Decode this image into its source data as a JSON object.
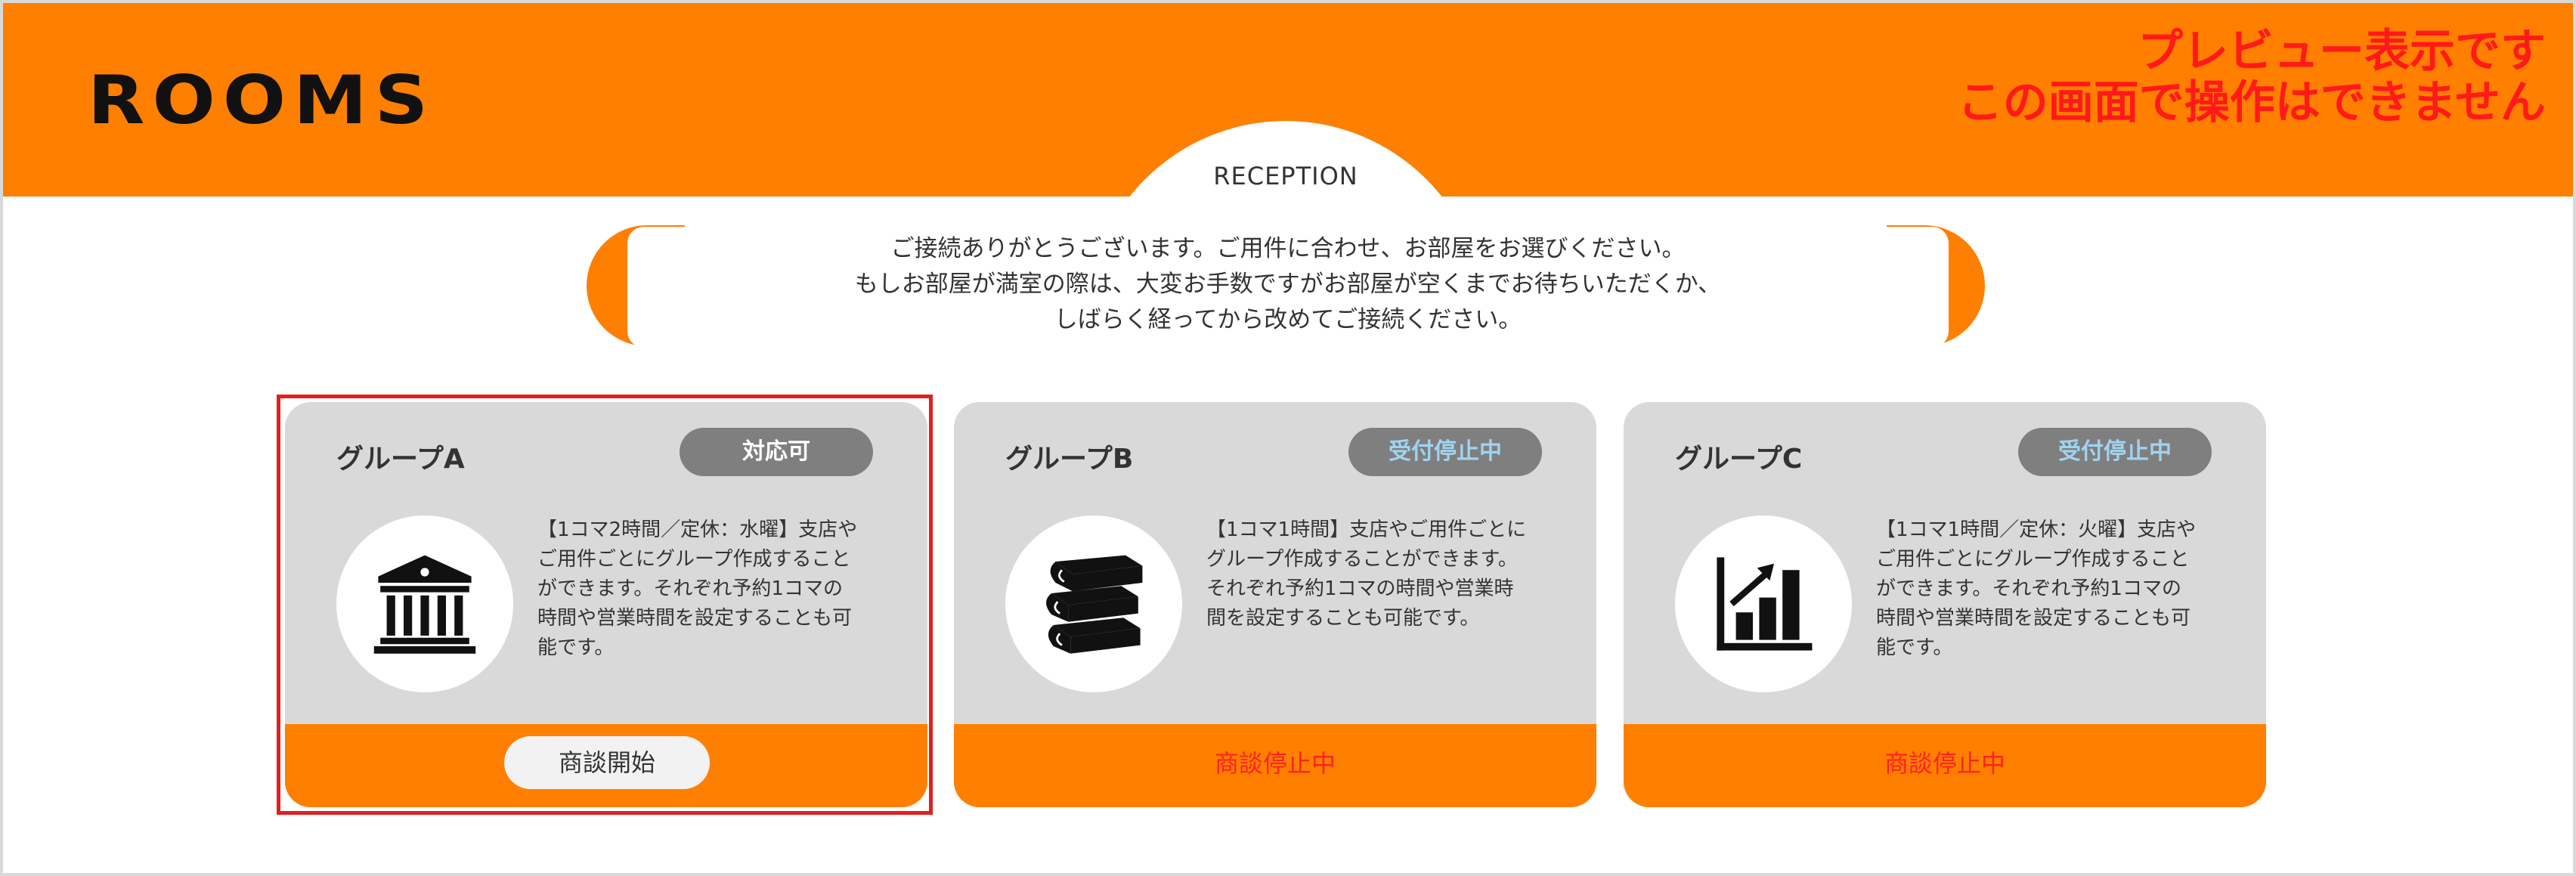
{
  "header": {
    "logo": "ROOMS",
    "preview_notice": [
      "プレビュー表示です",
      "この画面で操作はできません"
    ]
  },
  "reception": {
    "title": "RECEPTION",
    "message": [
      "ご接続ありがとうございます。ご用件に合わせ、お部屋をお選びください。",
      "もしお部屋が満室の際は、大変お手数ですがお部屋が空くまでお待ちいただくか、",
      "しばらく経ってから改めてご接続ください。"
    ]
  },
  "colors": {
    "accent": "#ff7f00",
    "card": "#d9d9d9",
    "badge": "#7f7f7f",
    "stopped_text": "#ff2222",
    "selection": "#e02020"
  },
  "groups": [
    {
      "name": "グループA",
      "status": "対応可",
      "icon": "bank-icon",
      "description": [
        "【1コマ2時間／定休：水曜】支店や",
        "ご用件ごとにグループ作成すること",
        "ができます。それぞれ予約1コマの",
        "時間や営業時間を設定することも可",
        "能です。"
      ],
      "action": "商談開始",
      "selected": true
    },
    {
      "name": "グループB",
      "status": "受付停止中",
      "icon": "books-icon",
      "description": [
        "【1コマ1時間】支店やご用件ごとに",
        "グループ作成することができます。",
        "それぞれ予約1コマの時間や営業時",
        "間を設定することも可能です。"
      ],
      "action": "商談停止中",
      "selected": false
    },
    {
      "name": "グループC",
      "status": "受付停止中",
      "icon": "chart-growth-icon",
      "description": [
        "【1コマ1時間／定休：火曜】支店や",
        "ご用件ごとにグループ作成すること",
        "ができます。それぞれ予約1コマの",
        "時間や営業時間を設定することも可",
        "能です。"
      ],
      "action": "商談停止中",
      "selected": false
    }
  ]
}
